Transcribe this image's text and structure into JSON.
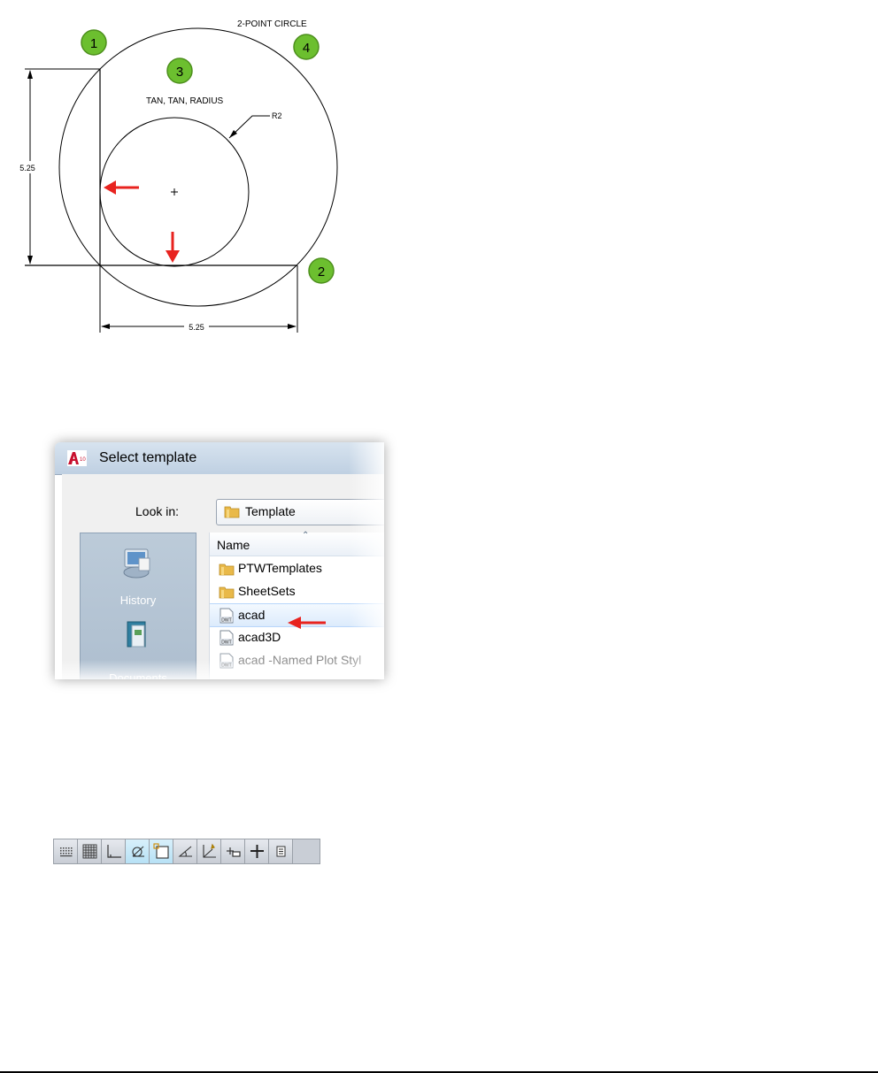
{
  "drawing": {
    "title_label": "2-POINT CIRCLE",
    "tan_label": "TAN, TAN, RADIUS",
    "radius_label": "R2",
    "dim_vertical": "5.25",
    "dim_horizontal": "5.25",
    "markers": [
      "1",
      "2",
      "3",
      "4"
    ],
    "colors": {
      "marker_fill": "#6cbf2f",
      "arrow": "#e8231f"
    }
  },
  "dialog": {
    "title": "Select template",
    "app_icon": "autocad-icon",
    "lookin_label": "Look in:",
    "lookin_value": "Template",
    "places": [
      {
        "label": "History",
        "icon": "history-icon"
      },
      {
        "label": "Documents",
        "icon": "documents-icon"
      }
    ],
    "column_header": "Name",
    "files": [
      {
        "name": "PTWTemplates",
        "type": "folder"
      },
      {
        "name": "SheetSets",
        "type": "folder"
      },
      {
        "name": "acad",
        "type": "dwt",
        "selected": true
      },
      {
        "name": "acad3D",
        "type": "dwt"
      },
      {
        "name": "acad -Named Plot Styl",
        "type": "dwt"
      }
    ]
  },
  "toolbar": {
    "buttons": [
      {
        "name": "snap-mode-icon",
        "on": false
      },
      {
        "name": "grid-display-icon",
        "on": false
      },
      {
        "name": "ortho-mode-icon",
        "on": false
      },
      {
        "name": "polar-tracking-icon",
        "on": true
      },
      {
        "name": "object-snap-icon",
        "on": true
      },
      {
        "name": "3d-object-snap-icon",
        "on": false
      },
      {
        "name": "dynamic-ucs-icon",
        "on": false
      },
      {
        "name": "dynamic-input-icon",
        "on": false
      },
      {
        "name": "lineweight-icon",
        "on": false
      },
      {
        "name": "quick-properties-icon",
        "on": false
      }
    ]
  }
}
